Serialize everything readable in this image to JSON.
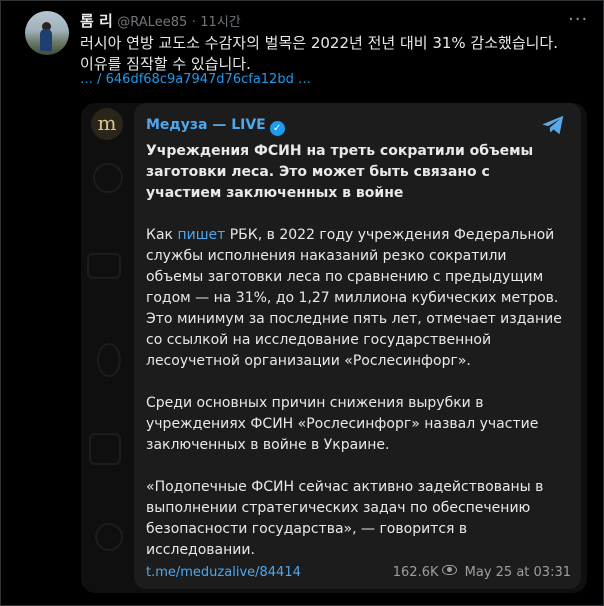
{
  "tweet": {
    "author_name": "롬 리",
    "handle": "@RALee85",
    "separator": "·",
    "time": "11시간",
    "text": "러시아 연방 교도소 수감자의 벌목은 2022년 전년 대비 31% 감소했습니다.\n이유를 짐작할 수 있습니다.",
    "link": "… / 646df68c9a7947d76cfa12bd …",
    "more_icon": "more-icon"
  },
  "embed": {
    "channel_name": "Медуза — LIVE",
    "logo_letter": "m",
    "headline": "Учреждения ФСИН на треть сократили объемы заготовки леса. Это может быть связано с участием заключенных в войне",
    "p1_before": "Как ",
    "p1_link": "пишет",
    "p1_after": " РБК, в 2022 году учреждения Федеральной службы исполнения наказаний резко сократили объемы заготовки леса по сравнению с предыдущим годом — на 31%, до 1,27 миллиона кубических метров. Это минимум за последние пять лет, отмечает издание со ссылкой на исследование государственной лесоучетной организации «Рослесинфорг».",
    "p2": "Среди основных причин снижения вырубки в учреждениях ФСИН «Рослесинфорг» назвал участие заключенных в войне в Украине.",
    "p3": "«Подопечные ФСИН сейчас активно задействованы в выполнении стратегических задач по обеспечению безопасности государства», — говорится в исследовании.",
    "post_link": "t.me/meduzalive/84414",
    "views": "162.6K",
    "date": "May 25 at 03:31",
    "colors": {
      "link": "#4fa8ee",
      "bubble": "#1c1c1d",
      "accent": "#1d9bf0"
    }
  }
}
